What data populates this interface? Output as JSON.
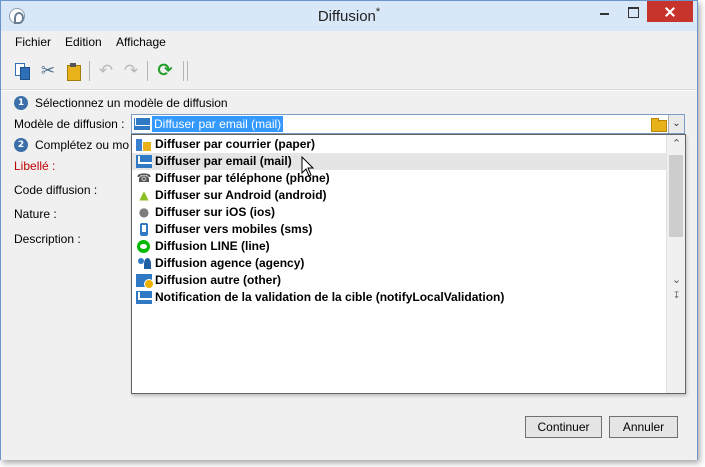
{
  "window": {
    "title": "Diffusion",
    "modified_marker": "*"
  },
  "menu": [
    "Fichier",
    "Edition",
    "Affichage"
  ],
  "toolbar": {
    "icons": [
      "copy-icon",
      "cut-icon",
      "paste-icon",
      "undo-icon",
      "redo-icon",
      "refresh-icon"
    ],
    "cut_glyph": "✂",
    "undo_glyph": "↶",
    "redo_glyph": "↷",
    "refresh_glyph": "⟳"
  },
  "steps": [
    {
      "number": "1",
      "text": "Sélectionnez un modèle de diffusion"
    },
    {
      "number": "2",
      "text": "Complétez ou mo"
    }
  ],
  "form": {
    "template_label": "Modèle de diffusion :",
    "template_value": "Diffuser par email (mail)",
    "labels": {
      "libelle": "Libellé :",
      "code": "Code diffusion :",
      "nature": "Nature :",
      "description": "Description :"
    }
  },
  "dropdown": {
    "hovered_index": 1,
    "options": [
      {
        "label": "Diffuser par courrier (paper)",
        "icon": "paper-mail-icon"
      },
      {
        "label": "Diffuser par email (mail)",
        "icon": "email-icon"
      },
      {
        "label": "Diffuser par téléphone (phone)",
        "icon": "phone-icon"
      },
      {
        "label": "Diffuser sur Android (android)",
        "icon": "android-icon"
      },
      {
        "label": "Diffuser sur iOS (ios)",
        "icon": "apple-icon"
      },
      {
        "label": "Diffuser vers mobiles (sms)",
        "icon": "mobile-icon"
      },
      {
        "label": "Diffusion LINE (line)",
        "icon": "line-icon"
      },
      {
        "label": "Diffusion agence (agency)",
        "icon": "agency-icon"
      },
      {
        "label": "Diffusion autre (other)",
        "icon": "other-icon"
      },
      {
        "label": "Notification de la validation de la cible (notifyLocalValidation)",
        "icon": "email-icon"
      }
    ]
  },
  "buttons": {
    "continue": "Continuer",
    "cancel": "Annuler"
  },
  "colors": {
    "selection": "#3399ff",
    "close_button": "#c7342c",
    "required_label": "#c00000"
  }
}
